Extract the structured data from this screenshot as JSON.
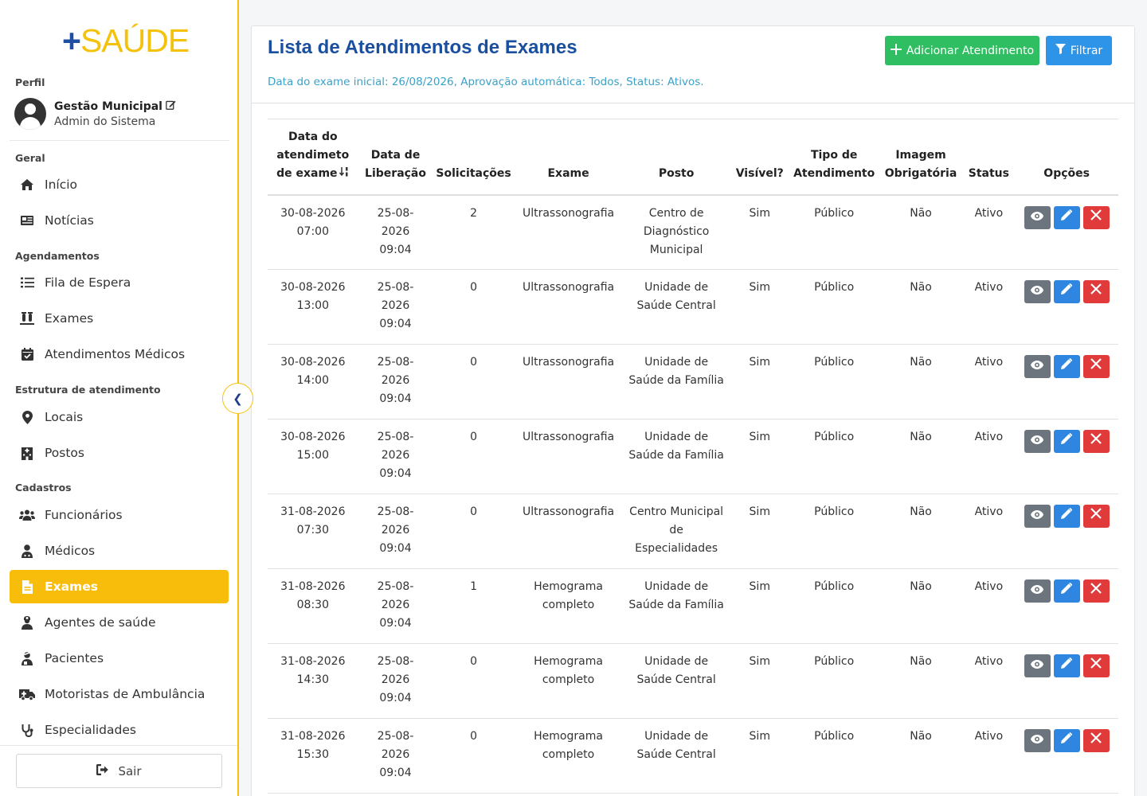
{
  "brand": {
    "plus": "+",
    "word": "SAÚDE"
  },
  "profile": {
    "section": "Perfil",
    "name": "Gestão Municipal",
    "role": "Admin do Sistema"
  },
  "sidebar": {
    "sections": {
      "geral": "Geral",
      "agendamentos": "Agendamentos",
      "estrutura": "Estrutura de atendimento",
      "cadastros": "Cadastros"
    },
    "items": [
      {
        "label": "Início",
        "icon": "home-icon"
      },
      {
        "label": "Notícias",
        "icon": "newspaper-icon"
      },
      {
        "label": "Fila de Espera",
        "icon": "list-icon"
      },
      {
        "label": "Exames",
        "icon": "vials-icon"
      },
      {
        "label": "Atendimentos Médicos",
        "icon": "calendar-check-icon"
      },
      {
        "label": "Locais",
        "icon": "map-marker-icon"
      },
      {
        "label": "Postos",
        "icon": "hospital-icon"
      },
      {
        "label": "Funcionários",
        "icon": "users-icon"
      },
      {
        "label": "Médicos",
        "icon": "user-doctor-icon"
      },
      {
        "label": "Exames",
        "icon": "file-medical-icon"
      },
      {
        "label": "Agentes de saúde",
        "icon": "user-nurse-icon"
      },
      {
        "label": "Pacientes",
        "icon": "user-injured-icon"
      },
      {
        "label": "Motoristas de Ambulância",
        "icon": "ambulance-icon"
      },
      {
        "label": "Especialidades",
        "icon": "stethoscope-icon"
      }
    ],
    "logout": "Sair",
    "collapse": "❮"
  },
  "header": {
    "title": "Lista de Atendimentos de Exames",
    "filter_info": "Data do exame inicial: 26/08/2026, Aprovação automática: Todos, Status: Ativos.",
    "add_button": "Adicionar Atendimento",
    "filter_button": "Filtrar"
  },
  "table": {
    "columns": {
      "c0a": "Data do",
      "c0b": "atendimeto",
      "c0c": "de exame",
      "c1a": "Data de",
      "c1b": "Liberação",
      "c2": "Solicitações",
      "c3": "Exame",
      "c4": "Posto",
      "c5": "Visível?",
      "c6a": "Tipo de",
      "c6b": "Atendimento",
      "c7a": "Imagem",
      "c7b": "Obrigatória",
      "c8": "Status",
      "c9": "Opções"
    },
    "rows": [
      {
        "d1": "30-08-2026",
        "d2": "07:00",
        "l1": "25-08-",
        "l2": "2026",
        "l3": "09:04",
        "sol": "2",
        "ex1": "Ultrassonografia",
        "ex2": "",
        "p1": "Centro de",
        "p2": "Diagnóstico",
        "p3": "Municipal",
        "vis": "Sim",
        "tipo": "Público",
        "img": "Não",
        "status": "Ativo"
      },
      {
        "d1": "30-08-2026",
        "d2": "13:00",
        "l1": "25-08-",
        "l2": "2026",
        "l3": "09:04",
        "sol": "0",
        "ex1": "Ultrassonografia",
        "ex2": "",
        "p1": "Unidade de",
        "p2": "Saúde Central",
        "p3": "",
        "vis": "Sim",
        "tipo": "Público",
        "img": "Não",
        "status": "Ativo"
      },
      {
        "d1": "30-08-2026",
        "d2": "14:00",
        "l1": "25-08-",
        "l2": "2026",
        "l3": "09:04",
        "sol": "0",
        "ex1": "Ultrassonografia",
        "ex2": "",
        "p1": "Unidade de",
        "p2": "Saúde da Família",
        "p3": "",
        "vis": "Sim",
        "tipo": "Público",
        "img": "Não",
        "status": "Ativo"
      },
      {
        "d1": "30-08-2026",
        "d2": "15:00",
        "l1": "25-08-",
        "l2": "2026",
        "l3": "09:04",
        "sol": "0",
        "ex1": "Ultrassonografia",
        "ex2": "",
        "p1": "Unidade de",
        "p2": "Saúde da Família",
        "p3": "",
        "vis": "Sim",
        "tipo": "Público",
        "img": "Não",
        "status": "Ativo"
      },
      {
        "d1": "31-08-2026",
        "d2": "07:30",
        "l1": "25-08-",
        "l2": "2026",
        "l3": "09:04",
        "sol": "0",
        "ex1": "Ultrassonografia",
        "ex2": "",
        "p1": "Centro Municipal",
        "p2": "de",
        "p3": "Especialidades",
        "vis": "Sim",
        "tipo": "Público",
        "img": "Não",
        "status": "Ativo"
      },
      {
        "d1": "31-08-2026",
        "d2": "08:30",
        "l1": "25-08-",
        "l2": "2026",
        "l3": "09:04",
        "sol": "1",
        "ex1": "Hemograma",
        "ex2": "completo",
        "p1": "Unidade de",
        "p2": "Saúde da Família",
        "p3": "",
        "vis": "Sim",
        "tipo": "Público",
        "img": "Não",
        "status": "Ativo"
      },
      {
        "d1": "31-08-2026",
        "d2": "14:30",
        "l1": "25-08-",
        "l2": "2026",
        "l3": "09:04",
        "sol": "0",
        "ex1": "Hemograma",
        "ex2": "completo",
        "p1": "Unidade de",
        "p2": "Saúde Central",
        "p3": "",
        "vis": "Sim",
        "tipo": "Público",
        "img": "Não",
        "status": "Ativo"
      },
      {
        "d1": "31-08-2026",
        "d2": "15:30",
        "l1": "25-08-",
        "l2": "2026",
        "l3": "09:04",
        "sol": "0",
        "ex1": "Hemograma",
        "ex2": "completo",
        "p1": "Unidade de",
        "p2": "Saúde Central",
        "p3": "",
        "vis": "Sim",
        "tipo": "Público",
        "img": "Não",
        "status": "Ativo"
      }
    ]
  },
  "colors": {
    "accent": "#f8bd0a",
    "brand_blue": "#1f4fa3",
    "add_green": "#2fbf62",
    "filter_blue": "#2e94e8",
    "delete_red": "#e03a3a",
    "view_gray": "#6c757d",
    "edit_blue": "#2e86e0"
  }
}
